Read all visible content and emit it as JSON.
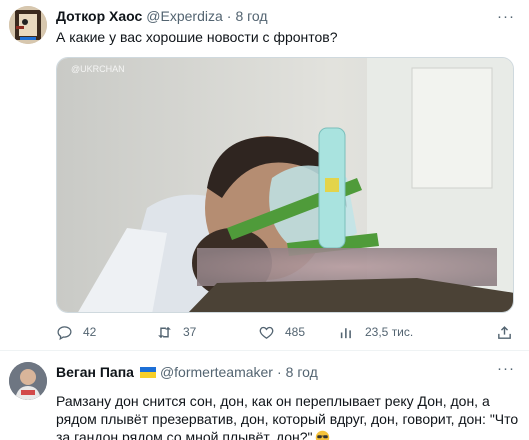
{
  "tweet1": {
    "author_name": "Доткор Хаос",
    "author_handle": "@Experdiza",
    "dot": "·",
    "time": "8 год",
    "text": "А какие у вас хорошие новости с фронтов?",
    "media_watermark": "@UKRCHAN",
    "more_icon": "more-icon",
    "stats": {
      "replies": "42",
      "retweets": "37",
      "likes": "485",
      "views": "23,5 тис."
    }
  },
  "tweet2": {
    "author_name": "Веган Папа",
    "author_handle": "@formerteamaker",
    "dot": "·",
    "time": "8 год",
    "text": "Рамзану дон снится сон, дон, как он переплывает реку Дон, дон, а рядом плывёт презерватив, дон, который вдруг, дон, говорит, дон: \"Что за гандон рядом со мной плывёт, дон?\"",
    "flag_colors": [
      "#1d6fd6",
      "#f7cf2a"
    ]
  },
  "colors": {
    "text_primary": "#0f1419",
    "text_secondary": "#536471",
    "border": "#cfd9de"
  }
}
